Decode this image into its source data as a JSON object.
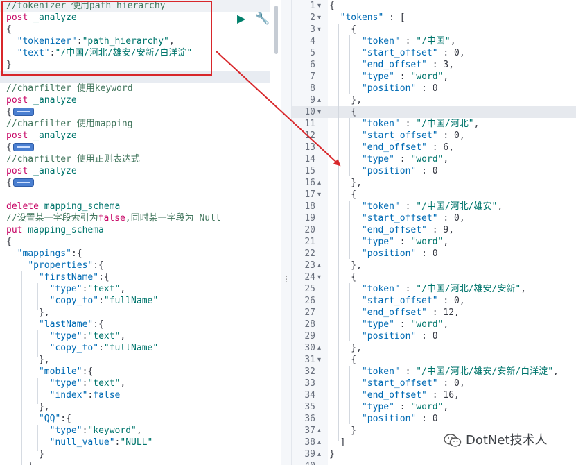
{
  "left_editor": {
    "lines": [
      [
        [
          "//tokenizer 使用path hierarchy",
          "c-comment"
        ]
      ],
      [
        [
          "post",
          "c-method"
        ],
        [
          " _analyze",
          "c-url"
        ]
      ],
      [
        [
          "{",
          "c-brace"
        ]
      ],
      [
        [
          "  ",
          "c-brace"
        ],
        [
          "\"tokenizer\"",
          "c-key"
        ],
        [
          ":",
          "c-brace"
        ],
        [
          "\"path_hierarchy\"",
          "c-str"
        ],
        [
          ",",
          "c-brace"
        ]
      ],
      [
        [
          "  ",
          "c-brace"
        ],
        [
          "\"text\"",
          "c-key"
        ],
        [
          ":",
          "c-brace"
        ],
        [
          "\"/中国/河北/雄安/安新/白洋淀\"",
          "c-str"
        ]
      ],
      [
        [
          "}",
          "c-brace"
        ]
      ],
      [
        [
          "",
          "c-brace"
        ]
      ],
      [
        [
          "//charfilter 使用keyword",
          "c-comment"
        ]
      ],
      [
        [
          "post",
          "c-method"
        ],
        [
          " _analyze",
          "c-url"
        ]
      ],
      [
        [
          "{",
          "c-brace"
        ],
        [
          "PILL",
          ""
        ]
      ],
      [
        [
          "//charfilter 使用mapping",
          "c-comment"
        ]
      ],
      [
        [
          "post",
          "c-method"
        ],
        [
          " _analyze",
          "c-url"
        ]
      ],
      [
        [
          "{",
          "c-brace"
        ],
        [
          "PILL",
          ""
        ]
      ],
      [
        [
          "//charfilter 使用正则表达式",
          "c-comment"
        ]
      ],
      [
        [
          "post",
          "c-method"
        ],
        [
          " _analyze",
          "c-url"
        ]
      ],
      [
        [
          "{",
          "c-brace"
        ],
        [
          "PILL",
          ""
        ]
      ],
      [
        [
          "",
          "c-brace"
        ]
      ],
      [
        [
          "delete",
          "c-method"
        ],
        [
          " mapping_schema",
          "c-url"
        ]
      ],
      [
        [
          "//设置某一字段索引为",
          "c-comment"
        ],
        [
          "false",
          "c-method"
        ],
        [
          ",同时某一字段为 Null",
          "c-comment"
        ]
      ],
      [
        [
          "put",
          "c-method"
        ],
        [
          " mapping_schema",
          "c-url"
        ]
      ],
      [
        [
          "{",
          "c-brace"
        ]
      ],
      [
        [
          "  ",
          "c-brace"
        ],
        [
          "\"mappings\"",
          "c-key"
        ],
        [
          ":{",
          "c-brace"
        ]
      ],
      [
        [
          "    ",
          "c-brace"
        ],
        [
          "\"properties\"",
          "c-key"
        ],
        [
          ":{",
          "c-brace"
        ]
      ],
      [
        [
          "      ",
          "c-brace"
        ],
        [
          "\"firstName\"",
          "c-key"
        ],
        [
          ":{",
          "c-brace"
        ]
      ],
      [
        [
          "        ",
          "c-brace"
        ],
        [
          "\"type\"",
          "c-key"
        ],
        [
          ":",
          "c-brace"
        ],
        [
          "\"text\"",
          "c-str"
        ],
        [
          ",",
          "c-brace"
        ]
      ],
      [
        [
          "        ",
          "c-brace"
        ],
        [
          "\"copy_to\"",
          "c-key"
        ],
        [
          ":",
          "c-brace"
        ],
        [
          "\"fullName\"",
          "c-str"
        ]
      ],
      [
        [
          "      },",
          "c-brace"
        ]
      ],
      [
        [
          "      ",
          "c-brace"
        ],
        [
          "\"lastName\"",
          "c-key"
        ],
        [
          ":{",
          "c-brace"
        ]
      ],
      [
        [
          "        ",
          "c-brace"
        ],
        [
          "\"type\"",
          "c-key"
        ],
        [
          ":",
          "c-brace"
        ],
        [
          "\"text\"",
          "c-str"
        ],
        [
          ",",
          "c-brace"
        ]
      ],
      [
        [
          "        ",
          "c-brace"
        ],
        [
          "\"copy_to\"",
          "c-key"
        ],
        [
          ":",
          "c-brace"
        ],
        [
          "\"fullName\"",
          "c-str"
        ]
      ],
      [
        [
          "      },",
          "c-brace"
        ]
      ],
      [
        [
          "      ",
          "c-brace"
        ],
        [
          "\"mobile\"",
          "c-key"
        ],
        [
          ":{",
          "c-brace"
        ]
      ],
      [
        [
          "        ",
          "c-brace"
        ],
        [
          "\"type\"",
          "c-key"
        ],
        [
          ":",
          "c-brace"
        ],
        [
          "\"text\"",
          "c-str"
        ],
        [
          ",",
          "c-brace"
        ]
      ],
      [
        [
          "        ",
          "c-brace"
        ],
        [
          "\"index\"",
          "c-key"
        ],
        [
          ":",
          "c-brace"
        ],
        [
          "false",
          "c-bool"
        ]
      ],
      [
        [
          "      },",
          "c-brace"
        ]
      ],
      [
        [
          "      ",
          "c-brace"
        ],
        [
          "\"QQ\"",
          "c-key"
        ],
        [
          ":{",
          "c-brace"
        ]
      ],
      [
        [
          "        ",
          "c-brace"
        ],
        [
          "\"type\"",
          "c-key"
        ],
        [
          ":",
          "c-brace"
        ],
        [
          "\"keyword\"",
          "c-str"
        ],
        [
          ",",
          "c-brace"
        ]
      ],
      [
        [
          "        ",
          "c-brace"
        ],
        [
          "\"null_value\"",
          "c-key"
        ],
        [
          ":",
          "c-brace"
        ],
        [
          "\"NULL\"",
          "c-str"
        ]
      ],
      [
        [
          "      }",
          "c-brace"
        ]
      ],
      [
        [
          "    }",
          "c-brace"
        ]
      ]
    ],
    "play_icon": "play-icon",
    "wrench_icon": "wrench-icon",
    "play_glyph": "▶",
    "wrench_glyph": "🔧"
  },
  "right_editor": {
    "line_numbers": [
      "1",
      "2",
      "3",
      "4",
      "5",
      "6",
      "7",
      "8",
      "9",
      "10",
      "11",
      "12",
      "13",
      "14",
      "15",
      "16",
      "17",
      "18",
      "19",
      "20",
      "21",
      "22",
      "23",
      "24",
      "25",
      "26",
      "27",
      "28",
      "29",
      "30",
      "31",
      "32",
      "33",
      "34",
      "35",
      "36",
      "37",
      "38",
      "39",
      "40"
    ],
    "fold_markers": {
      "1": "▾",
      "2": "▾",
      "3": "▾",
      "9": "▴",
      "10": "▾",
      "16": "▴",
      "17": "▾",
      "23": "▴",
      "24": "▾",
      "30": "▴",
      "31": "▾",
      "37": "▴",
      "38": "▴",
      "39": "▴"
    },
    "lines": [
      [
        [
          "{",
          "c-brace"
        ]
      ],
      [
        [
          "  ",
          "c-brace"
        ],
        [
          "\"tokens\"",
          "c-key"
        ],
        [
          " : [",
          "c-brace"
        ]
      ],
      [
        [
          "    {",
          "c-brace"
        ]
      ],
      [
        [
          "      ",
          "c-brace"
        ],
        [
          "\"token\"",
          "c-key"
        ],
        [
          " : ",
          "c-brace"
        ],
        [
          "\"/中国\"",
          "c-str"
        ],
        [
          ",",
          "c-brace"
        ]
      ],
      [
        [
          "      ",
          "c-brace"
        ],
        [
          "\"start_offset\"",
          "c-key"
        ],
        [
          " : ",
          "c-brace"
        ],
        [
          "0",
          "c-num"
        ],
        [
          ",",
          "c-brace"
        ]
      ],
      [
        [
          "      ",
          "c-brace"
        ],
        [
          "\"end_offset\"",
          "c-key"
        ],
        [
          " : ",
          "c-brace"
        ],
        [
          "3",
          "c-num"
        ],
        [
          ",",
          "c-brace"
        ]
      ],
      [
        [
          "      ",
          "c-brace"
        ],
        [
          "\"type\"",
          "c-key"
        ],
        [
          " : ",
          "c-brace"
        ],
        [
          "\"word\"",
          "c-str"
        ],
        [
          ",",
          "c-brace"
        ]
      ],
      [
        [
          "      ",
          "c-brace"
        ],
        [
          "\"position\"",
          "c-key"
        ],
        [
          " : ",
          "c-brace"
        ],
        [
          "0",
          "c-num"
        ]
      ],
      [
        [
          "    },",
          "c-brace"
        ]
      ],
      [
        [
          "    {",
          "c-brace"
        ]
      ],
      [
        [
          "      ",
          "c-brace"
        ],
        [
          "\"token\"",
          "c-key"
        ],
        [
          " : ",
          "c-brace"
        ],
        [
          "\"/中国/河北\"",
          "c-str"
        ],
        [
          ",",
          "c-brace"
        ]
      ],
      [
        [
          "      ",
          "c-brace"
        ],
        [
          "\"start_offset\"",
          "c-key"
        ],
        [
          " : ",
          "c-brace"
        ],
        [
          "0",
          "c-num"
        ],
        [
          ",",
          "c-brace"
        ]
      ],
      [
        [
          "      ",
          "c-brace"
        ],
        [
          "\"end_offset\"",
          "c-key"
        ],
        [
          " : ",
          "c-brace"
        ],
        [
          "6",
          "c-num"
        ],
        [
          ",",
          "c-brace"
        ]
      ],
      [
        [
          "      ",
          "c-brace"
        ],
        [
          "\"type\"",
          "c-key"
        ],
        [
          " : ",
          "c-brace"
        ],
        [
          "\"word\"",
          "c-str"
        ],
        [
          ",",
          "c-brace"
        ]
      ],
      [
        [
          "      ",
          "c-brace"
        ],
        [
          "\"position\"",
          "c-key"
        ],
        [
          " : ",
          "c-brace"
        ],
        [
          "0",
          "c-num"
        ]
      ],
      [
        [
          "    },",
          "c-brace"
        ]
      ],
      [
        [
          "    {",
          "c-brace"
        ]
      ],
      [
        [
          "      ",
          "c-brace"
        ],
        [
          "\"token\"",
          "c-key"
        ],
        [
          " : ",
          "c-brace"
        ],
        [
          "\"/中国/河北/雄安\"",
          "c-str"
        ],
        [
          ",",
          "c-brace"
        ]
      ],
      [
        [
          "      ",
          "c-brace"
        ],
        [
          "\"start_offset\"",
          "c-key"
        ],
        [
          " : ",
          "c-brace"
        ],
        [
          "0",
          "c-num"
        ],
        [
          ",",
          "c-brace"
        ]
      ],
      [
        [
          "      ",
          "c-brace"
        ],
        [
          "\"end_offset\"",
          "c-key"
        ],
        [
          " : ",
          "c-brace"
        ],
        [
          "9",
          "c-num"
        ],
        [
          ",",
          "c-brace"
        ]
      ],
      [
        [
          "      ",
          "c-brace"
        ],
        [
          "\"type\"",
          "c-key"
        ],
        [
          " : ",
          "c-brace"
        ],
        [
          "\"word\"",
          "c-str"
        ],
        [
          ",",
          "c-brace"
        ]
      ],
      [
        [
          "      ",
          "c-brace"
        ],
        [
          "\"position\"",
          "c-key"
        ],
        [
          " : ",
          "c-brace"
        ],
        [
          "0",
          "c-num"
        ]
      ],
      [
        [
          "    },",
          "c-brace"
        ]
      ],
      [
        [
          "    {",
          "c-brace"
        ]
      ],
      [
        [
          "      ",
          "c-brace"
        ],
        [
          "\"token\"",
          "c-key"
        ],
        [
          " : ",
          "c-brace"
        ],
        [
          "\"/中国/河北/雄安/安新\"",
          "c-str"
        ],
        [
          ",",
          "c-brace"
        ]
      ],
      [
        [
          "      ",
          "c-brace"
        ],
        [
          "\"start_offset\"",
          "c-key"
        ],
        [
          " : ",
          "c-brace"
        ],
        [
          "0",
          "c-num"
        ],
        [
          ",",
          "c-brace"
        ]
      ],
      [
        [
          "      ",
          "c-brace"
        ],
        [
          "\"end_offset\"",
          "c-key"
        ],
        [
          " : ",
          "c-brace"
        ],
        [
          "12",
          "c-num"
        ],
        [
          ",",
          "c-brace"
        ]
      ],
      [
        [
          "      ",
          "c-brace"
        ],
        [
          "\"type\"",
          "c-key"
        ],
        [
          " : ",
          "c-brace"
        ],
        [
          "\"word\"",
          "c-str"
        ],
        [
          ",",
          "c-brace"
        ]
      ],
      [
        [
          "      ",
          "c-brace"
        ],
        [
          "\"position\"",
          "c-key"
        ],
        [
          " : ",
          "c-brace"
        ],
        [
          "0",
          "c-num"
        ]
      ],
      [
        [
          "    },",
          "c-brace"
        ]
      ],
      [
        [
          "    {",
          "c-brace"
        ]
      ],
      [
        [
          "      ",
          "c-brace"
        ],
        [
          "\"token\"",
          "c-key"
        ],
        [
          " : ",
          "c-brace"
        ],
        [
          "\"/中国/河北/雄安/安新/白洋淀\"",
          "c-str"
        ],
        [
          ",",
          "c-brace"
        ]
      ],
      [
        [
          "      ",
          "c-brace"
        ],
        [
          "\"start_offset\"",
          "c-key"
        ],
        [
          " : ",
          "c-brace"
        ],
        [
          "0",
          "c-num"
        ],
        [
          ",",
          "c-brace"
        ]
      ],
      [
        [
          "      ",
          "c-brace"
        ],
        [
          "\"end_offset\"",
          "c-key"
        ],
        [
          " : ",
          "c-brace"
        ],
        [
          "16",
          "c-num"
        ],
        [
          ",",
          "c-brace"
        ]
      ],
      [
        [
          "      ",
          "c-brace"
        ],
        [
          "\"type\"",
          "c-key"
        ],
        [
          " : ",
          "c-brace"
        ],
        [
          "\"word\"",
          "c-str"
        ],
        [
          ",",
          "c-brace"
        ]
      ],
      [
        [
          "      ",
          "c-brace"
        ],
        [
          "\"position\"",
          "c-key"
        ],
        [
          " : ",
          "c-brace"
        ],
        [
          "0",
          "c-num"
        ]
      ],
      [
        [
          "    }",
          "c-brace"
        ]
      ],
      [
        [
          "  ]",
          "c-brace"
        ]
      ],
      [
        [
          "}",
          "c-brace"
        ]
      ],
      [
        [
          "",
          "c-brace"
        ]
      ]
    ]
  },
  "watermark": {
    "text": "DotNet技术人",
    "icon": "wechat-icon"
  },
  "colors": {
    "highlight_box": "#d8272b",
    "arrow": "#d8272b",
    "play": "#00806b",
    "wrench": "#2f6fbf"
  }
}
